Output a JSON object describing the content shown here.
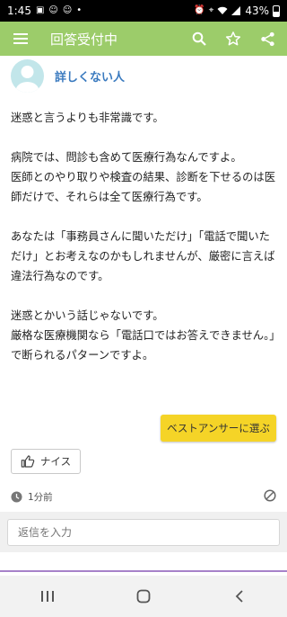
{
  "status_bar": {
    "time": "1:45",
    "battery": "43%",
    "notification_icons": [
      "photo-icon",
      "app-icon",
      "app-icon",
      "dot-icon"
    ],
    "system_icons": [
      "alarm-icon",
      "location-icon",
      "wifi-icon",
      "signal-icon",
      "battery-icon"
    ]
  },
  "app_bar": {
    "title": "回答受付中",
    "background": "#9ccc6a",
    "icons": [
      "menu-icon",
      "search-icon",
      "star-icon",
      "share-icon"
    ]
  },
  "answer": {
    "author": "詳しくない人",
    "paragraphs": [
      "迷惑と言うよりも非常識です。",
      "病院では、問診も含めて医療行為なんですよ。\n医師とのやり取りや検査の結果、診断を下せるのは医師だけで、それらは全て医療行為です。",
      "あなたは「事務員さんに聞いただけ」「電話で聞いただけ」とお考えなのかもしれませんが、厳密に言えば違法行為なのです。",
      "迷惑とかいう話じゃないです。\n厳格な医療機関なら「電話口ではお答えできません。」で断られるパターンですよ。"
    ],
    "best_answer_button": "ベストアンサーに選ぶ",
    "nice_button": "ナイス",
    "time": "1分前"
  },
  "reply": {
    "placeholder": "返信を入力"
  },
  "colors": {
    "accent": "#9ccc6a",
    "author_link": "#3a7abf",
    "best_button": "#f5d427",
    "divider": "#a782c9"
  }
}
